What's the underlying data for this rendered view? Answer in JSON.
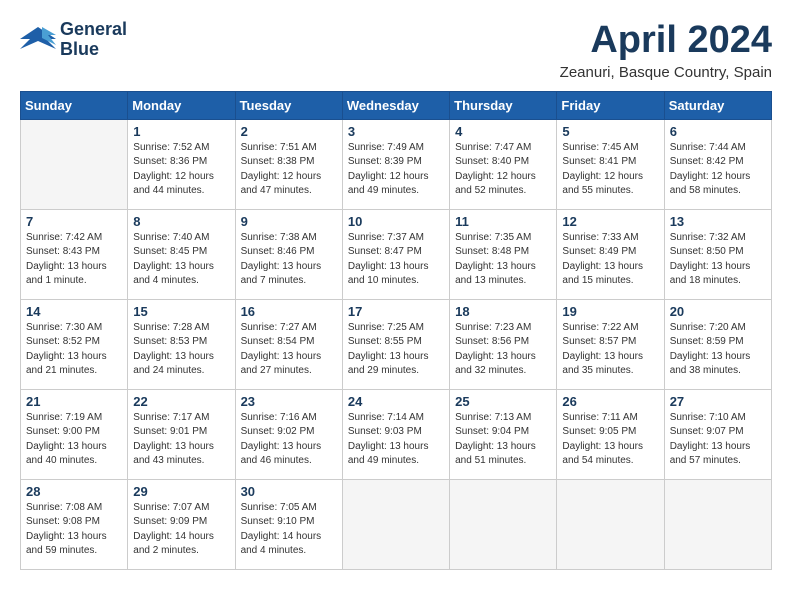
{
  "logo": {
    "line1": "General",
    "line2": "Blue"
  },
  "title": "April 2024",
  "subtitle": "Zeanuri, Basque Country, Spain",
  "days_header": [
    "Sunday",
    "Monday",
    "Tuesday",
    "Wednesday",
    "Thursday",
    "Friday",
    "Saturday"
  ],
  "weeks": [
    [
      {
        "num": "",
        "sunrise": "",
        "sunset": "",
        "daylight": ""
      },
      {
        "num": "1",
        "sunrise": "Sunrise: 7:52 AM",
        "sunset": "Sunset: 8:36 PM",
        "daylight": "Daylight: 12 hours and 44 minutes."
      },
      {
        "num": "2",
        "sunrise": "Sunrise: 7:51 AM",
        "sunset": "Sunset: 8:38 PM",
        "daylight": "Daylight: 12 hours and 47 minutes."
      },
      {
        "num": "3",
        "sunrise": "Sunrise: 7:49 AM",
        "sunset": "Sunset: 8:39 PM",
        "daylight": "Daylight: 12 hours and 49 minutes."
      },
      {
        "num": "4",
        "sunrise": "Sunrise: 7:47 AM",
        "sunset": "Sunset: 8:40 PM",
        "daylight": "Daylight: 12 hours and 52 minutes."
      },
      {
        "num": "5",
        "sunrise": "Sunrise: 7:45 AM",
        "sunset": "Sunset: 8:41 PM",
        "daylight": "Daylight: 12 hours and 55 minutes."
      },
      {
        "num": "6",
        "sunrise": "Sunrise: 7:44 AM",
        "sunset": "Sunset: 8:42 PM",
        "daylight": "Daylight: 12 hours and 58 minutes."
      }
    ],
    [
      {
        "num": "7",
        "sunrise": "Sunrise: 7:42 AM",
        "sunset": "Sunset: 8:43 PM",
        "daylight": "Daylight: 13 hours and 1 minute."
      },
      {
        "num": "8",
        "sunrise": "Sunrise: 7:40 AM",
        "sunset": "Sunset: 8:45 PM",
        "daylight": "Daylight: 13 hours and 4 minutes."
      },
      {
        "num": "9",
        "sunrise": "Sunrise: 7:38 AM",
        "sunset": "Sunset: 8:46 PM",
        "daylight": "Daylight: 13 hours and 7 minutes."
      },
      {
        "num": "10",
        "sunrise": "Sunrise: 7:37 AM",
        "sunset": "Sunset: 8:47 PM",
        "daylight": "Daylight: 13 hours and 10 minutes."
      },
      {
        "num": "11",
        "sunrise": "Sunrise: 7:35 AM",
        "sunset": "Sunset: 8:48 PM",
        "daylight": "Daylight: 13 hours and 13 minutes."
      },
      {
        "num": "12",
        "sunrise": "Sunrise: 7:33 AM",
        "sunset": "Sunset: 8:49 PM",
        "daylight": "Daylight: 13 hours and 15 minutes."
      },
      {
        "num": "13",
        "sunrise": "Sunrise: 7:32 AM",
        "sunset": "Sunset: 8:50 PM",
        "daylight": "Daylight: 13 hours and 18 minutes."
      }
    ],
    [
      {
        "num": "14",
        "sunrise": "Sunrise: 7:30 AM",
        "sunset": "Sunset: 8:52 PM",
        "daylight": "Daylight: 13 hours and 21 minutes."
      },
      {
        "num": "15",
        "sunrise": "Sunrise: 7:28 AM",
        "sunset": "Sunset: 8:53 PM",
        "daylight": "Daylight: 13 hours and 24 minutes."
      },
      {
        "num": "16",
        "sunrise": "Sunrise: 7:27 AM",
        "sunset": "Sunset: 8:54 PM",
        "daylight": "Daylight: 13 hours and 27 minutes."
      },
      {
        "num": "17",
        "sunrise": "Sunrise: 7:25 AM",
        "sunset": "Sunset: 8:55 PM",
        "daylight": "Daylight: 13 hours and 29 minutes."
      },
      {
        "num": "18",
        "sunrise": "Sunrise: 7:23 AM",
        "sunset": "Sunset: 8:56 PM",
        "daylight": "Daylight: 13 hours and 32 minutes."
      },
      {
        "num": "19",
        "sunrise": "Sunrise: 7:22 AM",
        "sunset": "Sunset: 8:57 PM",
        "daylight": "Daylight: 13 hours and 35 minutes."
      },
      {
        "num": "20",
        "sunrise": "Sunrise: 7:20 AM",
        "sunset": "Sunset: 8:59 PM",
        "daylight": "Daylight: 13 hours and 38 minutes."
      }
    ],
    [
      {
        "num": "21",
        "sunrise": "Sunrise: 7:19 AM",
        "sunset": "Sunset: 9:00 PM",
        "daylight": "Daylight: 13 hours and 40 minutes."
      },
      {
        "num": "22",
        "sunrise": "Sunrise: 7:17 AM",
        "sunset": "Sunset: 9:01 PM",
        "daylight": "Daylight: 13 hours and 43 minutes."
      },
      {
        "num": "23",
        "sunrise": "Sunrise: 7:16 AM",
        "sunset": "Sunset: 9:02 PM",
        "daylight": "Daylight: 13 hours and 46 minutes."
      },
      {
        "num": "24",
        "sunrise": "Sunrise: 7:14 AM",
        "sunset": "Sunset: 9:03 PM",
        "daylight": "Daylight: 13 hours and 49 minutes."
      },
      {
        "num": "25",
        "sunrise": "Sunrise: 7:13 AM",
        "sunset": "Sunset: 9:04 PM",
        "daylight": "Daylight: 13 hours and 51 minutes."
      },
      {
        "num": "26",
        "sunrise": "Sunrise: 7:11 AM",
        "sunset": "Sunset: 9:05 PM",
        "daylight": "Daylight: 13 hours and 54 minutes."
      },
      {
        "num": "27",
        "sunrise": "Sunrise: 7:10 AM",
        "sunset": "Sunset: 9:07 PM",
        "daylight": "Daylight: 13 hours and 57 minutes."
      }
    ],
    [
      {
        "num": "28",
        "sunrise": "Sunrise: 7:08 AM",
        "sunset": "Sunset: 9:08 PM",
        "daylight": "Daylight: 13 hours and 59 minutes."
      },
      {
        "num": "29",
        "sunrise": "Sunrise: 7:07 AM",
        "sunset": "Sunset: 9:09 PM",
        "daylight": "Daylight: 14 hours and 2 minutes."
      },
      {
        "num": "30",
        "sunrise": "Sunrise: 7:05 AM",
        "sunset": "Sunset: 9:10 PM",
        "daylight": "Daylight: 14 hours and 4 minutes."
      },
      {
        "num": "",
        "sunrise": "",
        "sunset": "",
        "daylight": ""
      },
      {
        "num": "",
        "sunrise": "",
        "sunset": "",
        "daylight": ""
      },
      {
        "num": "",
        "sunrise": "",
        "sunset": "",
        "daylight": ""
      },
      {
        "num": "",
        "sunrise": "",
        "sunset": "",
        "daylight": ""
      }
    ]
  ]
}
